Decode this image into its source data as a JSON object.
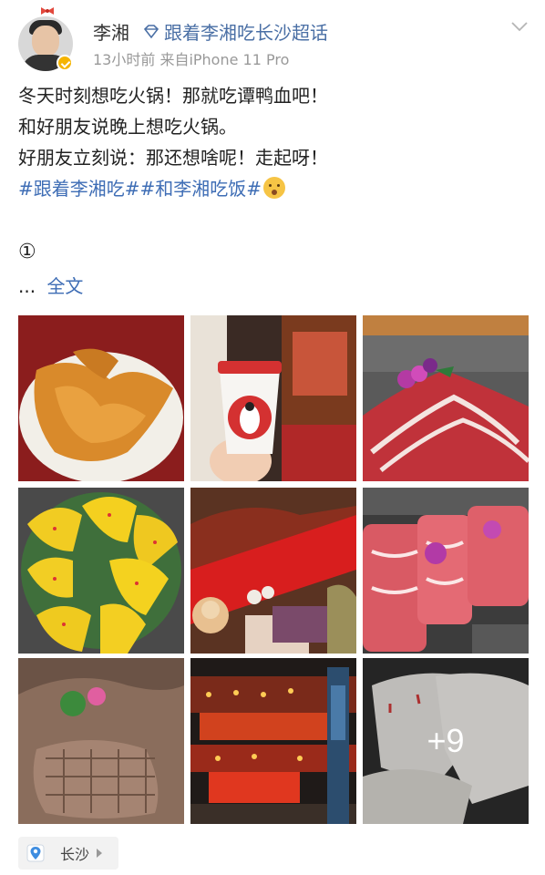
{
  "post": {
    "username": "李湘",
    "topic": "跟着李湘吃长沙超话",
    "meta": "13小时前  来自iPhone 11 Pro",
    "lines": [
      "冬天时刻想吃火锅！那就吃谭鸭血吧！",
      "和好朋友说晚上想吃火锅。",
      "好朋友立刻说：那还想啥呢！走起呀！"
    ],
    "hashtags": "#跟着李湘吃##和李湘吃饭#",
    "circled_number": "①",
    "ellipsis": "...",
    "full_text_link": "全文",
    "more_photos": "+9",
    "location": "长沙"
  },
  "colors": {
    "link": "#3e6db5",
    "topic": "#4a6fa5",
    "meta": "#999999",
    "verified_badge": "#f5b400"
  },
  "icons": {
    "topic": "diamond-topic-icon",
    "verified": "verified-badge-icon",
    "more": "chevron-down-icon",
    "location": "location-pin-icon"
  }
}
